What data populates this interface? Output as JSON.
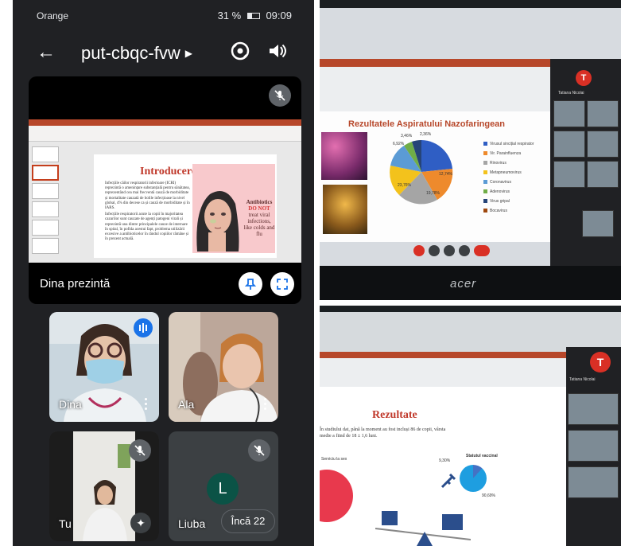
{
  "phone": {
    "status": {
      "carrier": "Orange",
      "battery": "31 %",
      "time": "09:09"
    },
    "meeting_code": "put-cbqc-fvw",
    "presenter_label": "Dina prezintă",
    "slide": {
      "title": "Introducere",
      "bullet1": "Infecțiile căilor respiratorii inferioare (ICRI) reprezintă o amenințare substanțială pentru sănătatea, reprezentând cea mai frecventă cauză de morbiditate și mortalitate cauzată de bolile infecțioase la nivel global, 4% din decese ca și cauză de morbiditate și în IARS.",
      "bullet2": "Infecțiile respiratorii acute la copii în majoritatea cazurilor sunt cauzate de agenți patogeni virali și reprezintă una dintre principalele cauze de internare în spital, în pofida acestui fapt, problema utilizării excesive a antibioticelor în rândul copiilor rămâne și în prezent actuală.",
      "card_text_1": "Antibiotics",
      "card_text_2": "DO NOT",
      "card_text_3": "treat viral infections, like colds and flu"
    },
    "participants": [
      {
        "name": "Dina",
        "speaking": true
      },
      {
        "name": "Ala",
        "speaking": false
      },
      {
        "name": "Tu",
        "muted": true
      },
      {
        "name": "Liuba",
        "avatar_letter": "L",
        "muted": true
      }
    ],
    "more_participants": "Încă 22"
  },
  "photo1": {
    "chart_title": "Rezultatele Aspiratului Nazofaringean",
    "pie_labels": [
      "3,46%",
      "2,36%",
      "6,92%",
      "12,74%",
      "23,76%",
      "19,78%"
    ],
    "legend": [
      "Virusul sincițial respirator",
      "Vir. Parainfluenza",
      "Rinovirus",
      "Metapneumovirus",
      "Coronavirus",
      "Adenovirus",
      "Virus gripal",
      "Bocavirus"
    ],
    "avatar_letter": "T",
    "tile_name": "Tatiana Nicolai",
    "monitor_brand": "acer"
  },
  "photo2": {
    "title": "Rezultate",
    "text": "În studiului dat, până la moment au fost incluși 86 de copii, vârsta medie a fiind de 18 ± 1,6 luni.",
    "chart_left_label": "Serviciu la sex",
    "chart_right_title": "Statutul vaccinal",
    "pct_a": "9,30%",
    "pct_b": "90,69%",
    "avatar_letter": "T",
    "tile_name": "Tatiana Nicolai"
  }
}
